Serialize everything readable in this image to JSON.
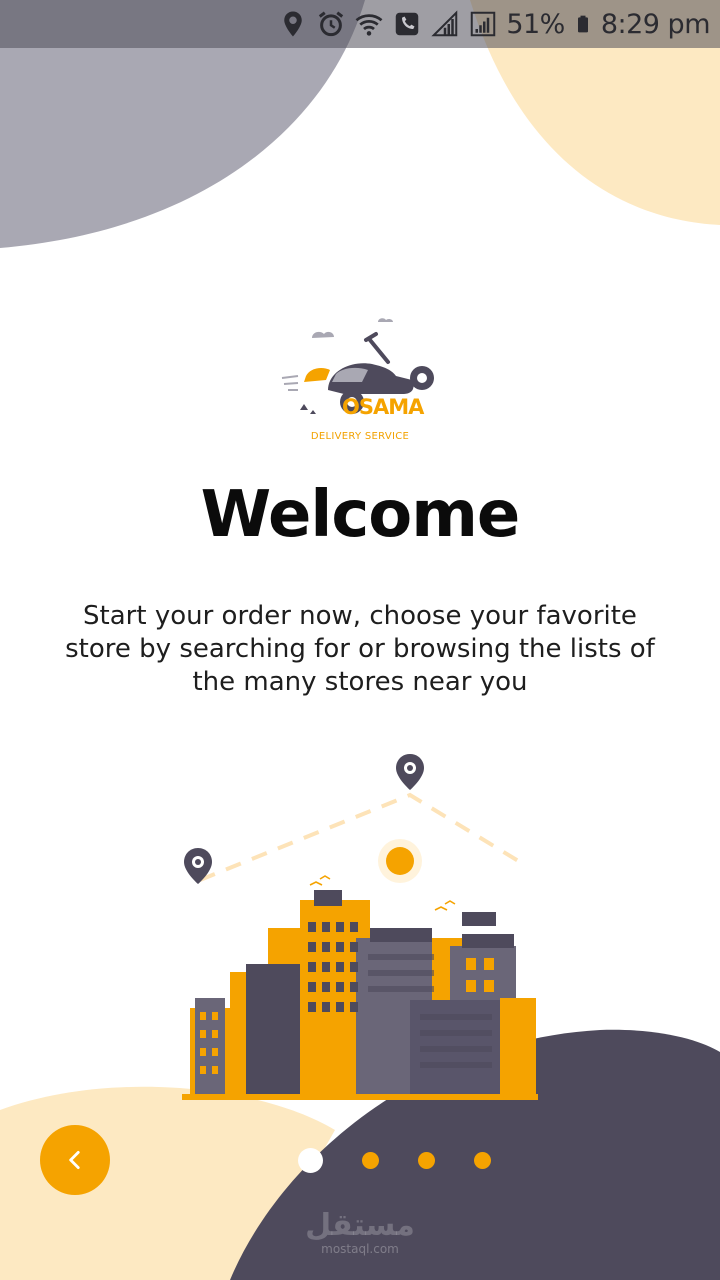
{
  "status_bar": {
    "battery": "51%",
    "time": "8:29 pm",
    "icons": [
      "location-icon",
      "alarm-icon",
      "wifi-icon",
      "call-icon",
      "signal-icon",
      "signal-icon",
      "battery-icon"
    ]
  },
  "logo": {
    "brand": "OSAMA",
    "tagline": "DELIVERY SERVICE"
  },
  "onboarding": {
    "title": "Welcome",
    "description": "Start your order now, choose your favorite store by searching for or browsing the lists of the many stores near you"
  },
  "pager": {
    "total_pages": 4,
    "current_page": 1
  },
  "controls": {
    "back_icon": "chevron-left-icon"
  },
  "watermark": {
    "arabic": "مستقل",
    "latin": "mostaql.com"
  },
  "colors": {
    "accent": "#f5a300",
    "dark_blob": "#4e4a5c",
    "gray_blob": "#a9a8b3",
    "peach_blob": "#fde9c2",
    "text": "#0b0b0b"
  }
}
